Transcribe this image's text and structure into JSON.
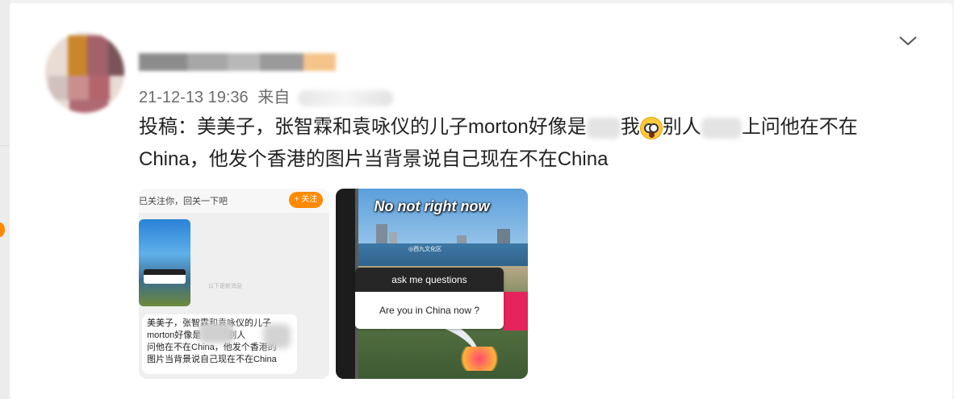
{
  "post": {
    "timestamp": "21-12-13 19:36",
    "source_prefix": "来自",
    "text_line1_a": "投稿：美美子，张智霖和袁咏仪的儿子morton好像是",
    "text_line1_b": "我",
    "text_line1_c": "别人",
    "text_line1_d": "上问他在不在",
    "text_line2": "China，他发个香港的图片当背景说自己现在不在China"
  },
  "menu": {
    "icon": "chevron-down-icon"
  },
  "image1": {
    "follow_text": "已关注你，回关一下吧",
    "follow_button": "+ 关注",
    "faint_text": "以下是新消息",
    "bubble_lines": [
      "美美子，张智霖和袁咏仪的儿子",
      "morton好像是　　　别人",
      "问他在不在China，他发个香港的",
      "图片当背景说自己现在不在China"
    ]
  },
  "image2": {
    "headline": "No not right now",
    "location": "◎西九文化区",
    "question_header": "ask me questions",
    "question_body": "Are you in China now ?"
  },
  "colors": {
    "accent_orange": "#ff8a00",
    "text_primary": "#222222",
    "text_secondary": "#6b6b6b"
  }
}
